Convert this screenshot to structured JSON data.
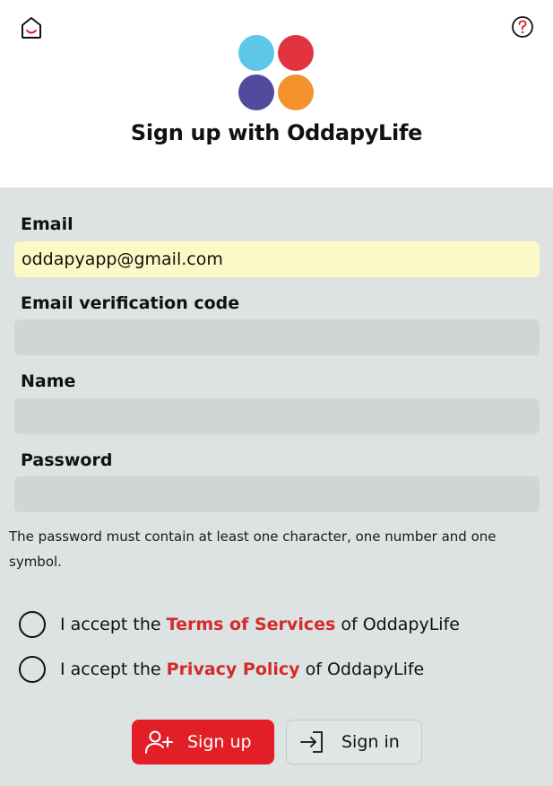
{
  "header": {
    "title": "Sign up with OddapyLife",
    "logo_colors": [
      "#5ec6e8",
      "#e13340",
      "#514a9e",
      "#f4922e"
    ]
  },
  "form": {
    "email": {
      "label": "Email",
      "value": "oddapyapp@gmail.com",
      "placeholder": ""
    },
    "verification": {
      "label": "Email verification code",
      "value": "",
      "placeholder": ""
    },
    "name": {
      "label": "Name",
      "value": "",
      "placeholder": ""
    },
    "password": {
      "label": "Password",
      "value": "",
      "placeholder": ""
    },
    "password_hint": "The password must contain at least one character, one number and one symbol."
  },
  "agreements": {
    "terms": {
      "prefix": "I accept the ",
      "link": "Terms of Services",
      "suffix": " of OddapyLife"
    },
    "privacy": {
      "prefix": "I accept the ",
      "link": "Privacy Policy",
      "suffix": " of OddapyLife"
    }
  },
  "actions": {
    "signup_label": "Sign up",
    "signin_label": "Sign in"
  },
  "colors": {
    "accent": "#e21f26",
    "link": "#d42a2a",
    "form_background": "#dde2e2",
    "autofill": "#fdf9c6"
  }
}
